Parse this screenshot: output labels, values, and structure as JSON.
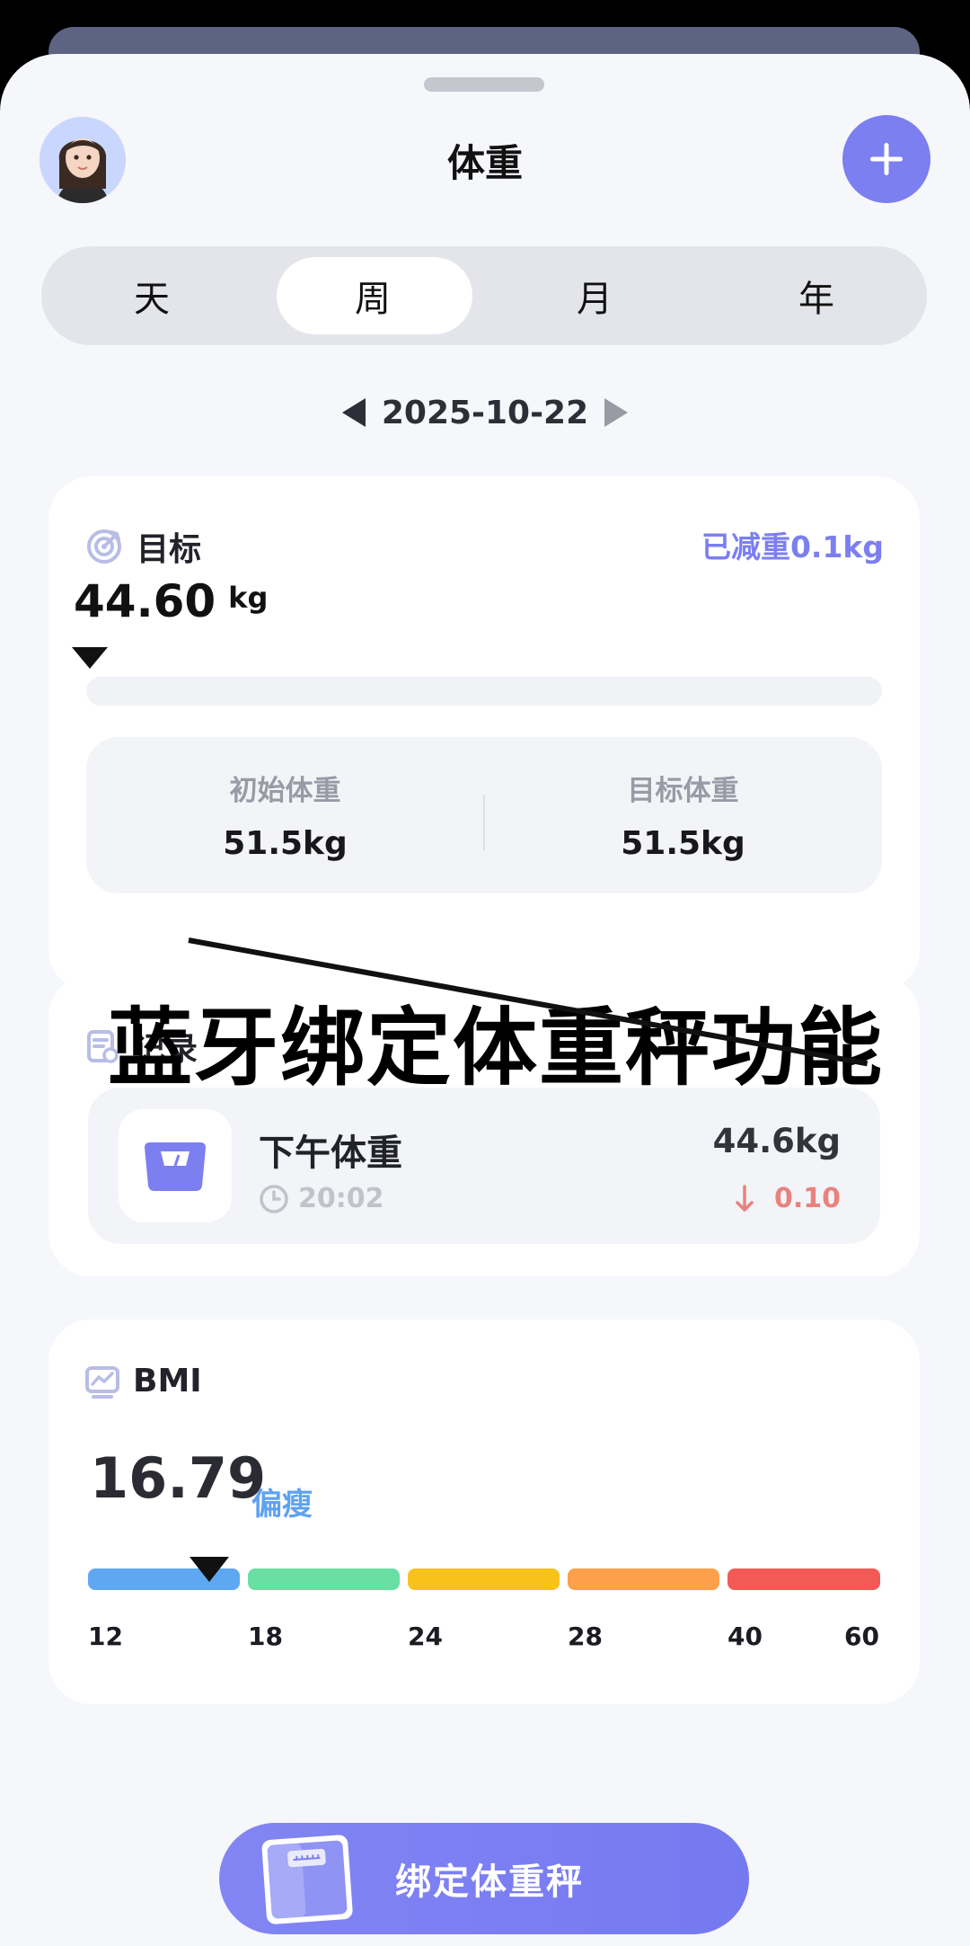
{
  "header": {
    "title": "体重",
    "avatar_icon": "avatar-girl",
    "add_icon": "plus-icon"
  },
  "tabs": [
    "天",
    "周",
    "月",
    "年"
  ],
  "active_tab": "周",
  "date": {
    "value": "2025-10-22"
  },
  "goal": {
    "label": "目标",
    "loss_text": "已减重0.1kg",
    "current_value": "44.60",
    "current_unit": "kg",
    "initial_label": "初始体重",
    "initial_value": "51.5kg",
    "target_label": "目标体重",
    "target_value": "51.5kg"
  },
  "record": {
    "label": "记录",
    "item": {
      "name": "下午体重",
      "time": "20:02",
      "weight": "44.6kg",
      "change": "0.10",
      "change_direction": "down"
    }
  },
  "bmi": {
    "label": "BMI",
    "value": "16.79",
    "status": "偏瘦",
    "ticks": [
      "12",
      "18",
      "24",
      "28",
      "40",
      "60"
    ],
    "segment_colors": [
      "#5ea8f1",
      "#69dfa3",
      "#f8c21d",
      "#fca04c",
      "#f25a55"
    ]
  },
  "overlay": {
    "text": "蓝牙绑定体重秤功能"
  },
  "bind_button": {
    "label": "绑定体重秤"
  },
  "colors": {
    "accent": "#7b7ff0",
    "background": "#f6f7fb",
    "down_change": "#e9827f"
  }
}
